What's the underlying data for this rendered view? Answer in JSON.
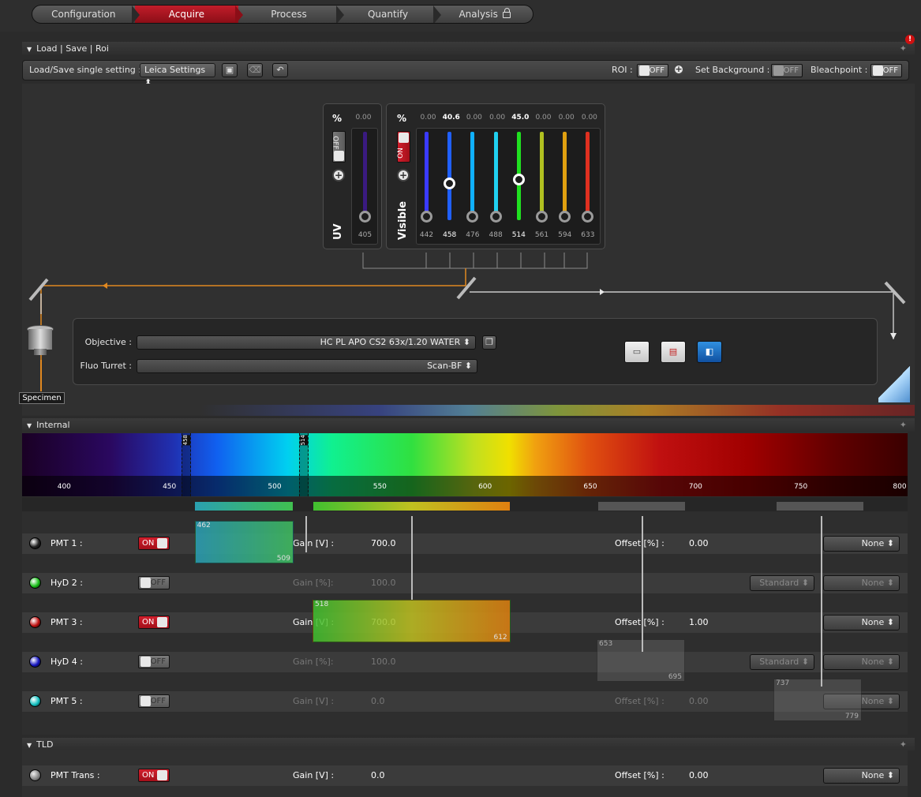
{
  "workflow": {
    "tabs": [
      "Configuration",
      "Acquire",
      "Process",
      "Quantify",
      "Analysis"
    ],
    "active": "Acquire"
  },
  "load_section": {
    "title": "Load | Save | Roi",
    "single_setting_label": "Load/Save single setting :",
    "setting_value": "Leica Settings",
    "roi_label": "ROI :",
    "roi_state": "OFF",
    "set_background_label": "Set Background :",
    "set_background_state": "OFF",
    "bleachpoint_label": "Bleachpoint :",
    "bleachpoint_state": "OFF"
  },
  "uv_laser": {
    "pct_label": "%",
    "value": "0.00",
    "state": "OFF",
    "name": "UV",
    "wavelength": "405"
  },
  "visible_laser": {
    "pct_label": "%",
    "state": "ON",
    "name": "Visible",
    "lines": [
      {
        "wl": "442",
        "value": "0.00",
        "level": 0,
        "color": "#3a3aff"
      },
      {
        "wl": "458",
        "value": "40.6",
        "level": 40.6,
        "color": "#2060ff"
      },
      {
        "wl": "476",
        "value": "0.00",
        "level": 0,
        "color": "#10b0ff"
      },
      {
        "wl": "488",
        "value": "0.00",
        "level": 0,
        "color": "#20d0f0"
      },
      {
        "wl": "514",
        "value": "45.0",
        "level": 45.0,
        "color": "#20e020"
      },
      {
        "wl": "561",
        "value": "0.00",
        "level": 0,
        "color": "#b0c020"
      },
      {
        "wl": "594",
        "value": "0.00",
        "level": 0,
        "color": "#e0a010"
      },
      {
        "wl": "633",
        "value": "0.00",
        "level": 0,
        "color": "#e03020"
      }
    ]
  },
  "beam": {
    "objective_label": "Objective :",
    "objective_value": "HC PL APO CS2   63x/1.20 WATER",
    "turret_label": "Fluo Turret :",
    "turret_value": "Scan-BF",
    "specimen_label": "Specimen"
  },
  "internal_section": {
    "title": "Internal",
    "spectrum_ticks": [
      "400",
      "450",
      "500",
      "550",
      "600",
      "650",
      "700",
      "750",
      "800"
    ],
    "laser_markers": [
      "458",
      "514"
    ]
  },
  "detectors": [
    {
      "name": "PMT 1 :",
      "state": "ON",
      "gain_label": "Gain [V] :",
      "gain": "700.0",
      "offset_label": "Offset [%] :",
      "offset": "0.00",
      "mode": "",
      "lut": "None",
      "dot": "#222",
      "band_lo": "462",
      "band_hi": "509"
    },
    {
      "name": "HyD 2 :",
      "state": "OFF",
      "gain_label": "Gain [%]:",
      "gain": "100.0",
      "offset_label": "",
      "offset": "",
      "mode": "Standard",
      "lut": "None",
      "dot": "#19c019",
      "band_lo": "",
      "band_hi": ""
    },
    {
      "name": "PMT 3 :",
      "state": "ON",
      "gain_label": "Gain [V] :",
      "gain": "700.0",
      "offset_label": "Offset [%] :",
      "offset": "1.00",
      "mode": "",
      "lut": "None",
      "dot": "#c01010",
      "band_lo": "518",
      "band_hi": "612"
    },
    {
      "name": "HyD 4 :",
      "state": "OFF",
      "gain_label": "Gain [%]:",
      "gain": "100.0",
      "offset_label": "",
      "offset": "",
      "mode": "Standard",
      "lut": "None",
      "dot": "#1515c0",
      "band_lo": "653",
      "band_hi": "695"
    },
    {
      "name": "PMT 5 :",
      "state": "OFF",
      "gain_label": "Gain [V] :",
      "gain": "0.0",
      "offset_label": "Offset [%] :",
      "offset": "0.00",
      "mode": "",
      "lut": "None",
      "dot": "#10c0c0",
      "band_lo": "737",
      "band_hi": "779"
    }
  ],
  "tld_section": {
    "title": "TLD",
    "name": "PMT Trans :",
    "state": "ON",
    "gain_label": "Gain [V] :",
    "gain": "0.0",
    "offset_label": "Offset [%] :",
    "offset": "0.00",
    "lut": "None"
  }
}
